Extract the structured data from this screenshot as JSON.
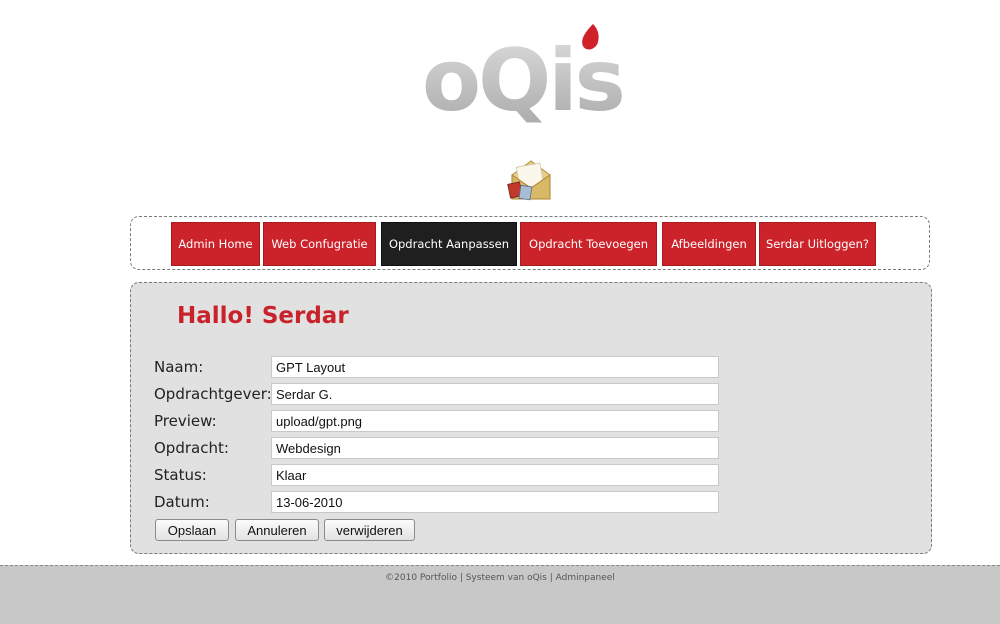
{
  "logo": {
    "text": "oQis"
  },
  "nav": {
    "items": [
      {
        "label": "Admin Home"
      },
      {
        "label": "Web Confugratie"
      },
      {
        "label": "Opdracht Aanpassen"
      },
      {
        "label": "Opdracht Toevoegen"
      },
      {
        "label": "Afbeeldingen"
      },
      {
        "label": "Serdar Uitloggen?"
      }
    ],
    "active": "Opdracht Aanpassen"
  },
  "greeting": "Hallo! Serdar",
  "form": {
    "fields": [
      {
        "label": "Naam:",
        "value": "GPT Layout"
      },
      {
        "label": "Opdrachtgever:",
        "value": "Serdar G."
      },
      {
        "label": "Preview:",
        "value": "upload/gpt.png"
      },
      {
        "label": "Opdracht:",
        "value": "Webdesign"
      },
      {
        "label": "Status:",
        "value": "Klaar"
      },
      {
        "label": "Datum:",
        "value": "13-06-2010"
      }
    ],
    "buttons": {
      "save": "Opslaan",
      "cancel": "Annuleren",
      "delete": "verwijderen"
    }
  },
  "footer": {
    "text": "©2010 Portfolio | Systeem van oQis | Adminpaneel"
  },
  "colors": {
    "accent": "#cc2229",
    "nav_active": "#1f1f1f",
    "panel_bg": "#e1e1e1",
    "footer_bg": "#c8c8c8"
  },
  "icons": {
    "header_icon": "mail-envelope-icon"
  }
}
